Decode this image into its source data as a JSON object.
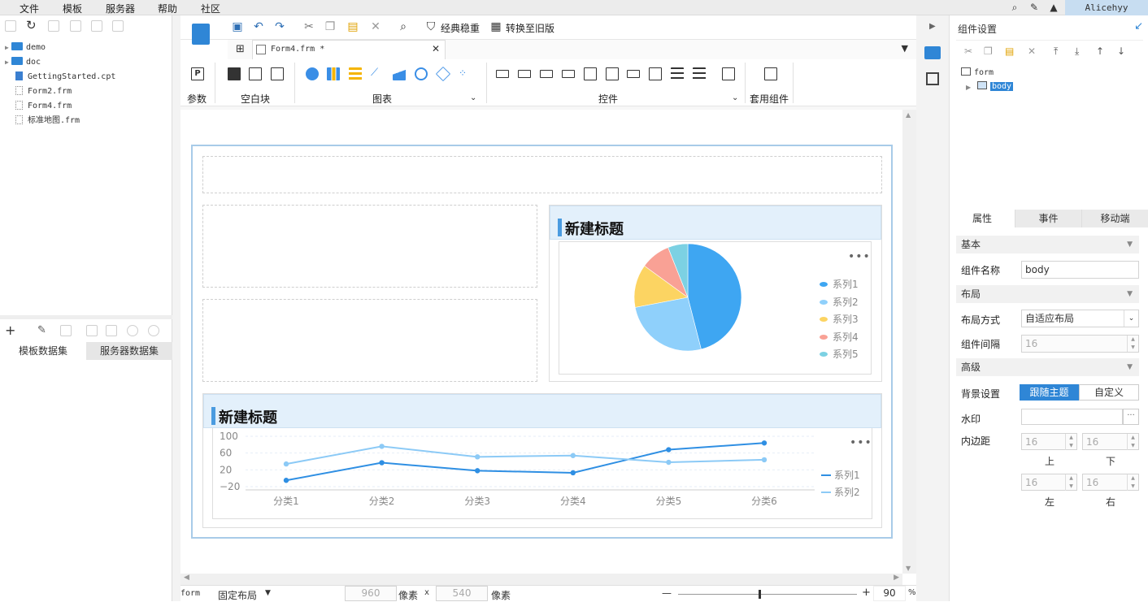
{
  "menu": {
    "items": [
      "文件",
      "模板",
      "服务器",
      "帮助",
      "社区"
    ],
    "user": "Alicehyy"
  },
  "left_panel": {
    "tree": [
      {
        "label": "demo",
        "type": "folder"
      },
      {
        "label": "doc",
        "type": "folder"
      },
      {
        "label": "GettingStarted.cpt",
        "type": "cpt"
      },
      {
        "label": "Form2.frm",
        "type": "frm"
      },
      {
        "label": "Form4.frm",
        "type": "frm"
      },
      {
        "label": "标准地图.frm",
        "type": "frm"
      }
    ],
    "dataset_tabs": [
      "模板数据集",
      "服务器数据集"
    ]
  },
  "editor": {
    "toolbar_buttons": [
      "经典稳重",
      "转换至旧版"
    ],
    "tab_label": "Form4.frm *",
    "ribbon_groups": [
      "参数",
      "空白块",
      "图表",
      "控件",
      "套用组件"
    ]
  },
  "canvas": {
    "pie_widget": {
      "title": "新建标题",
      "chart_data": {
        "type": "pie",
        "categories": [
          "系列1",
          "系列2",
          "系列3",
          "系列4",
          "系列5"
        ],
        "values": [
          46,
          26,
          13,
          9,
          6
        ],
        "legend_position": "right",
        "colors": [
          "#3ea6f2",
          "#8fd0fb",
          "#fcd462",
          "#f9a195",
          "#7cd1e3"
        ]
      }
    },
    "line_widget": {
      "title": "新建标题",
      "chart_data": {
        "type": "line",
        "categories": [
          "分类1",
          "分类2",
          "分类3",
          "分类4",
          "分类5",
          "分类6"
        ],
        "series": [
          {
            "name": "系列1",
            "values": [
              -5,
              37,
              18,
              13,
              68,
              84
            ],
            "color": "#2f8fe3"
          },
          {
            "name": "系列2",
            "values": [
              34,
              76,
              51,
              54,
              38,
              44
            ],
            "color": "#8ccaf6"
          }
        ],
        "ylim": [
          -20,
          100
        ],
        "yticks": [
          "100",
          "60",
          "20",
          "−20"
        ],
        "legend_position": "right"
      }
    }
  },
  "statusbar": {
    "label": "form",
    "layout": "固定布局",
    "width": "960",
    "unit1": "像素",
    "x": "x",
    "height": "540",
    "unit2": "像素",
    "minus": "—",
    "plus": "+",
    "zoom": "90",
    "pct": "%"
  },
  "right_panel": {
    "title": "组件设置",
    "tree": {
      "root": "form",
      "child": "body"
    },
    "tabs": [
      "属性",
      "事件",
      "移动端"
    ],
    "section_basic": "基本",
    "component_name_label": "组件名称",
    "component_name": "body",
    "section_layout": "布局",
    "layout_mode_label": "布局方式",
    "layout_mode": "自适应布局",
    "spacing_label": "组件间隔",
    "spacing": "16",
    "section_advanced": "高级",
    "bg_label": "背景设置",
    "bg_options": [
      "跟随主题",
      "自定义"
    ],
    "watermark_label": "水印",
    "padding_label": "内边距",
    "padding": {
      "top": "16",
      "bottom": "16",
      "left": "16",
      "right": "16"
    },
    "padding_labels": {
      "top": "上",
      "bottom": "下",
      "left": "左",
      "right": "右"
    }
  }
}
